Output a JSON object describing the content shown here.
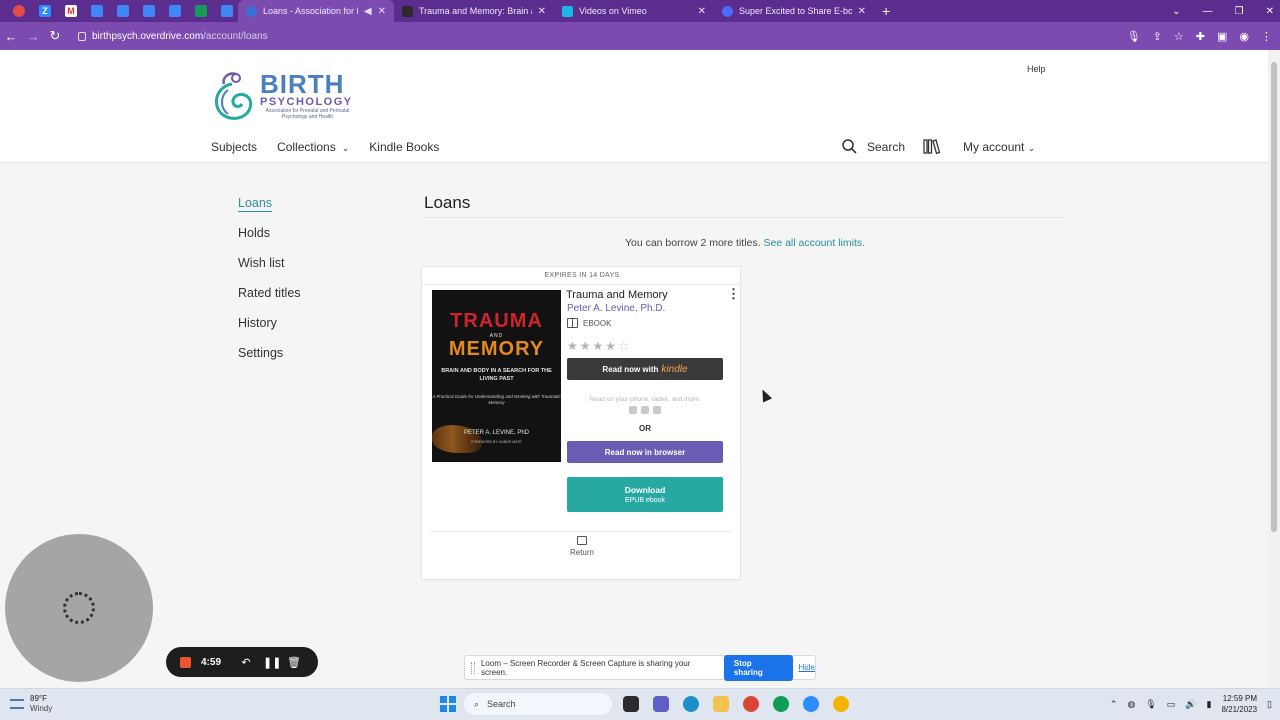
{
  "browser": {
    "tabs": [
      {
        "title": "Loans - Association for Prena",
        "active": true,
        "color": "#3b6fd8"
      },
      {
        "title": "Trauma and Memory: Brain and B",
        "active": false,
        "color": "#2b2b2b"
      },
      {
        "title": "Videos on Vimeo",
        "active": false,
        "color": "#1ab7ea"
      },
      {
        "title": "Super Excited to Share E-book Ti",
        "active": false,
        "color": "#4a6cf7"
      }
    ],
    "new_tab": "+",
    "url_host": "birthpsych.overdrive.com",
    "url_path": "/account/loans"
  },
  "logo": {
    "big": "BIRTH",
    "mid": "PSYCHOLOGY",
    "small": "Association for Prenatal and Perinatal Psychology and Health"
  },
  "header": {
    "help": "Help",
    "nav": {
      "subjects": "Subjects",
      "collections": "Collections",
      "kindle_books": "Kindle Books"
    },
    "search": "Search",
    "my_account": "My account"
  },
  "sidebar": {
    "items": [
      "Loans",
      "Holds",
      "Wish list",
      "Rated titles",
      "History",
      "Settings"
    ]
  },
  "main": {
    "title": "Loans",
    "borrow_note": "You can borrow 2 more titles.",
    "limits_link": "See all account limits."
  },
  "loan": {
    "expires": "EXPIRES IN 14 DAYS",
    "title": "Trauma and Memory",
    "author": "Peter A. Levine, Ph.D.",
    "format": "EBOOK",
    "rating": 4,
    "rating_max": 5,
    "kindle_prefix": "Read now with",
    "kindle_brand": "kindle",
    "device_note": "Read on your phone, tablet, and more.",
    "or": "OR",
    "read_browser": "Read now in browser",
    "download": "Download",
    "download_sub": "EPUB ebook",
    "return": "Return",
    "cover": {
      "line1": "TRAUMA",
      "line2": "AND",
      "line3": "MEMORY",
      "subtitle": "BRAIN AND BODY IN A SEARCH FOR THE LIVING PAST",
      "tagline": "A Practical Guide for Understanding and Working with Traumatic Memory",
      "author": "PETER A. LEVINE, PhD",
      "foreword": "FOREWORD BY GABOR MATÉ"
    }
  },
  "loom": {
    "time": "4:59",
    "share_text": "Loom – Screen Recorder & Screen Capture is sharing your screen.",
    "stop": "Stop sharing",
    "hide": "Hide"
  },
  "taskbar": {
    "temp": "89°F",
    "condition": "Windy",
    "search": "Search",
    "time": "12:59 PM",
    "date": "8/21/2023"
  },
  "colors": {
    "accent_purple": "#6a5bb3",
    "teal": "#27a8a2",
    "link": "#2a8fa0",
    "browser_frame": "#7b4bb0"
  }
}
